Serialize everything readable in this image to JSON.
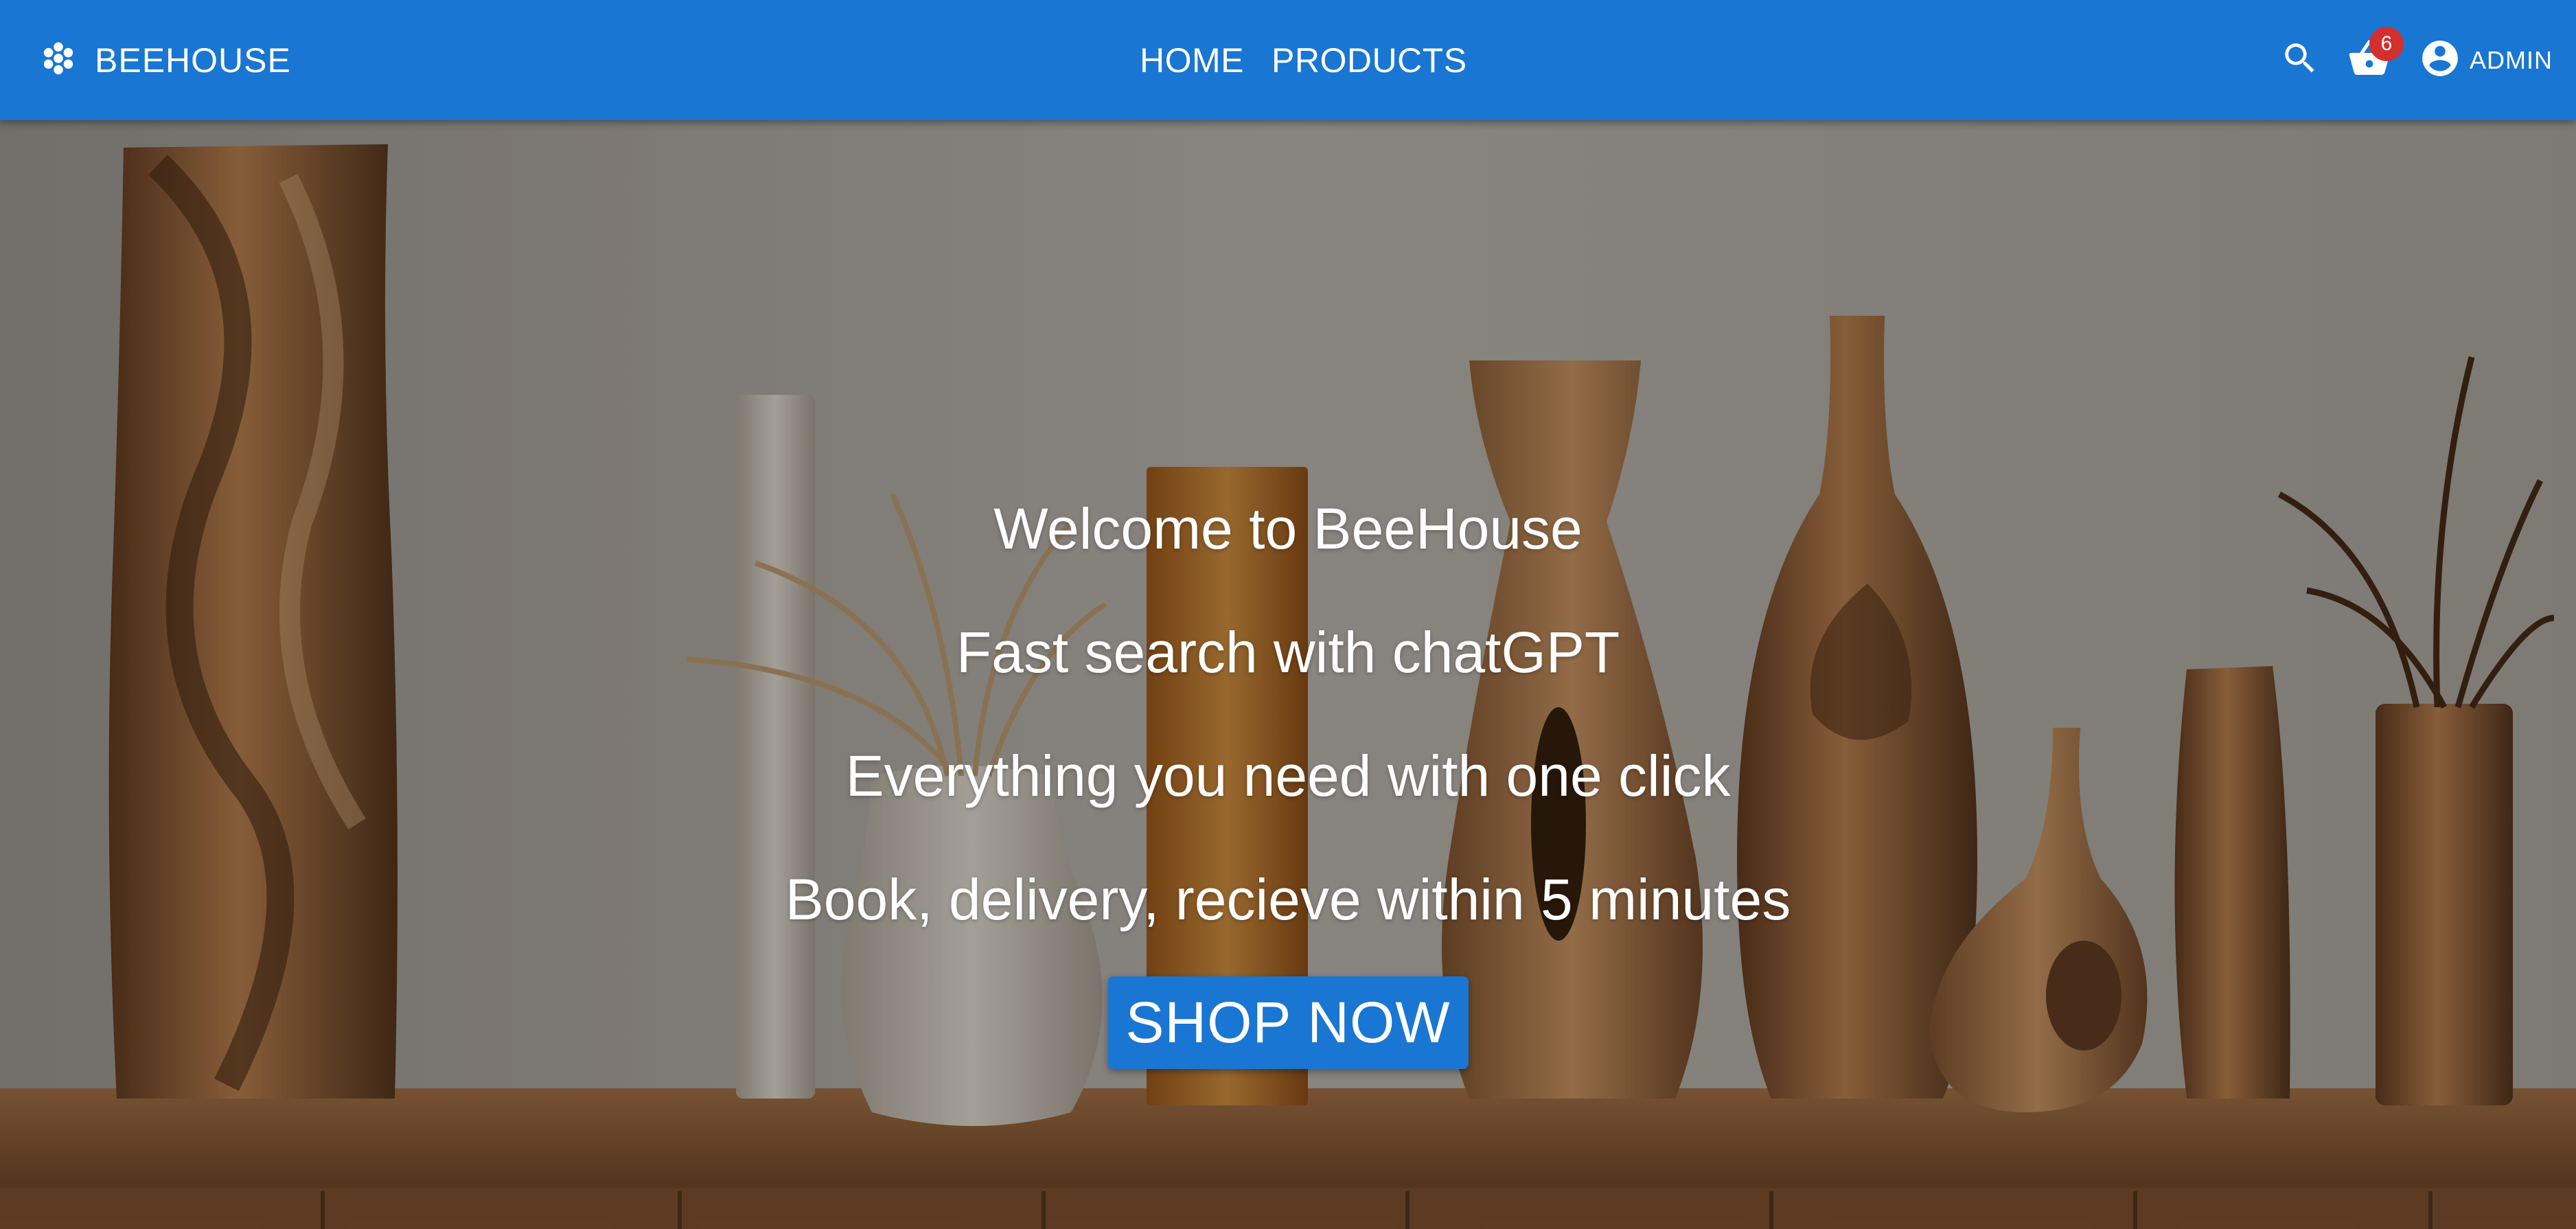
{
  "header": {
    "brand": "BEEHOUSE",
    "nav": [
      {
        "label": "HOME"
      },
      {
        "label": "PRODUCTS"
      }
    ],
    "cart_count": "6",
    "user_label": "ADMIN"
  },
  "hero": {
    "lines": [
      "Welcome to BeeHouse",
      "Fast search with chatGPT",
      "Everything you need with one click",
      "Book, delivery, recieve within 5 minutes"
    ],
    "cta_label": "SHOP NOW"
  },
  "colors": {
    "primary": "#1976d2",
    "badge": "#d32f2f"
  },
  "icons": [
    "hive-logo-icon",
    "search-icon",
    "cart-basket-icon",
    "account-circle-icon"
  ]
}
